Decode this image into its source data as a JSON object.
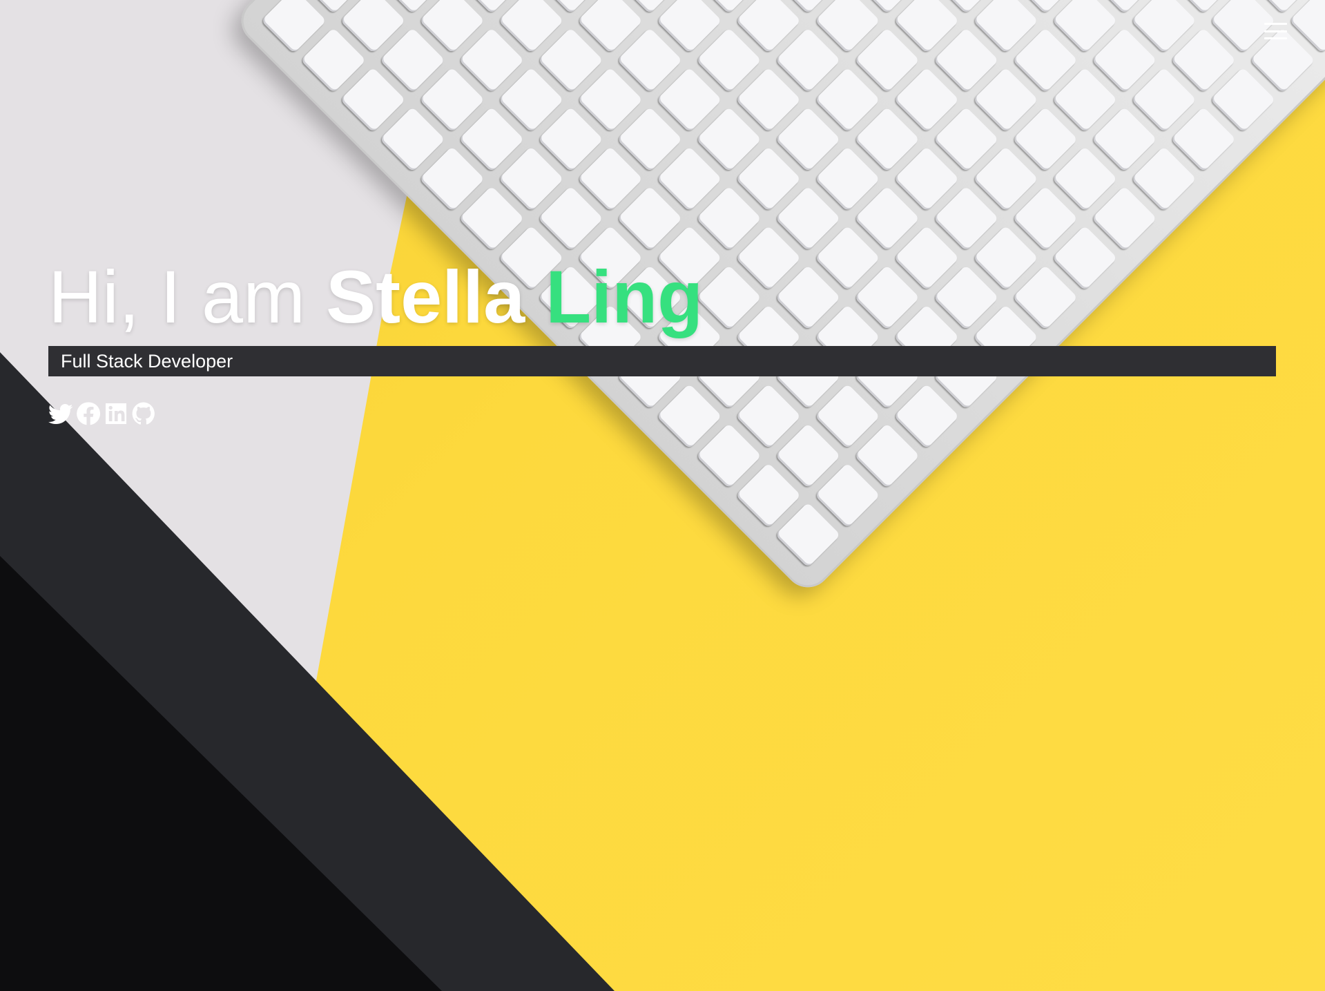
{
  "hero": {
    "greeting": "Hi, I am",
    "first_name": "Stella",
    "last_name": "Ling",
    "subtitle": "Full Stack Developer"
  },
  "social": {
    "items": [
      {
        "name": "Twitter",
        "icon": "twitter-icon"
      },
      {
        "name": "Facebook",
        "icon": "facebook-icon"
      },
      {
        "name": "LinkedIn",
        "icon": "linkedin-icon"
      },
      {
        "name": "GitHub",
        "icon": "github-icon"
      }
    ]
  },
  "nav": {
    "menu_icon": "hamburger-menu-icon"
  },
  "colors": {
    "accent": "#36e07f",
    "subtitle_bar": "#2f2f33",
    "text": "#ffffff",
    "background_yellow": "#fdd93d"
  }
}
